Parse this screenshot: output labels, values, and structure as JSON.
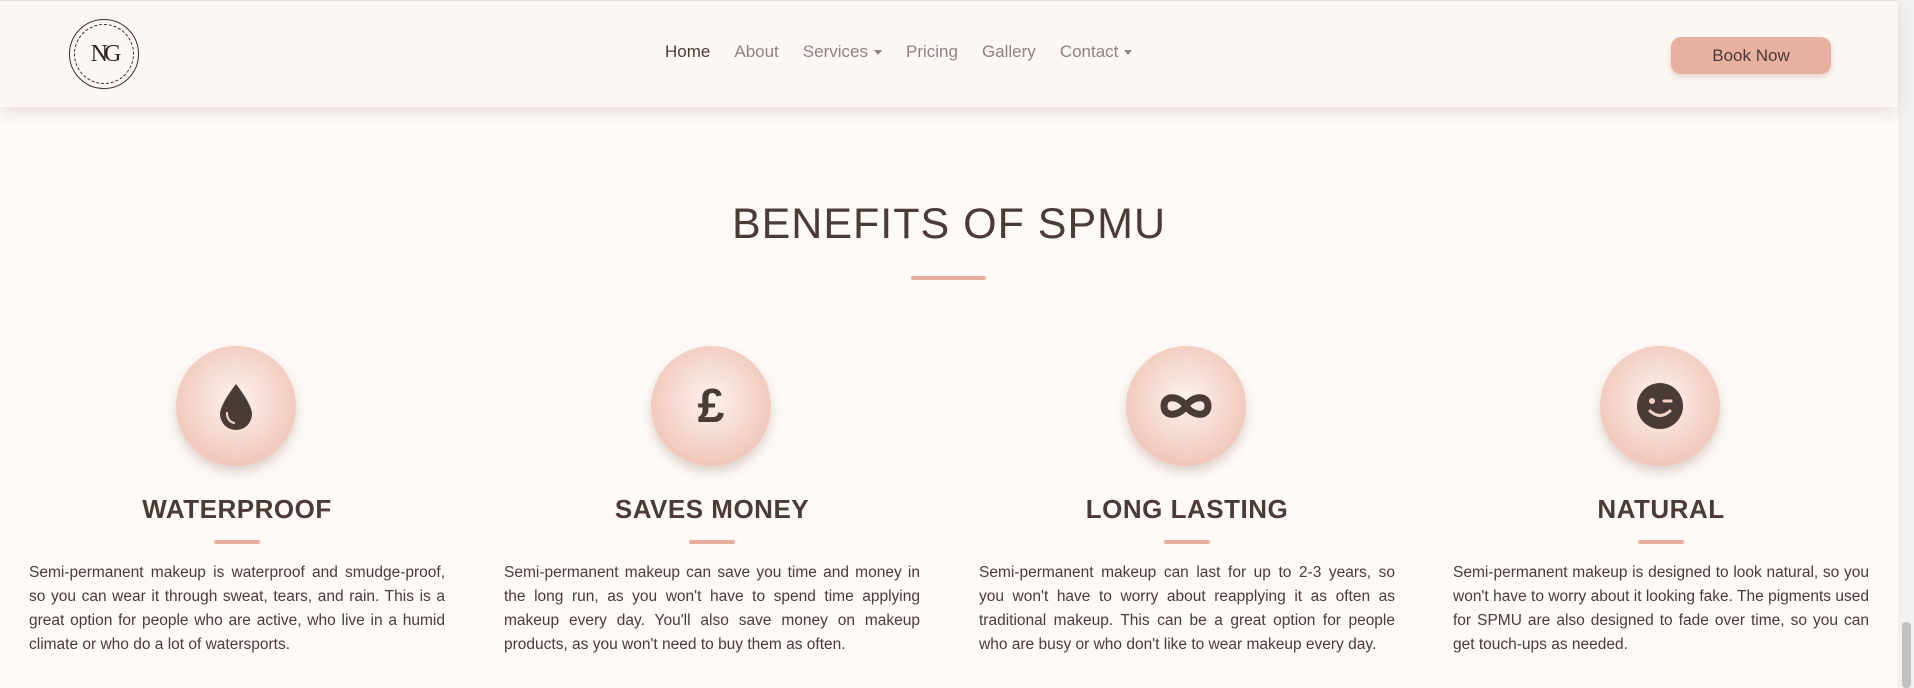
{
  "header": {
    "logo_text": "NG",
    "nav": [
      {
        "label": "Home",
        "dropdown": false,
        "active": true
      },
      {
        "label": "About",
        "dropdown": false,
        "active": false
      },
      {
        "label": "Services",
        "dropdown": true,
        "active": false
      },
      {
        "label": "Pricing",
        "dropdown": false,
        "active": false
      },
      {
        "label": "Gallery",
        "dropdown": false,
        "active": false
      },
      {
        "label": "Contact",
        "dropdown": true,
        "active": false
      }
    ],
    "book_button": "Book Now"
  },
  "section": {
    "title": "BENEFITS OF SPMU"
  },
  "benefits": [
    {
      "icon": "water-drop-icon",
      "title": "WATERPROOF",
      "text": "Semi-permanent makeup is waterproof and smudge-proof, so you can wear it through sweat, tears, and rain. This is a great option for people who are active, who live in a humid climate or who do a lot of watersports."
    },
    {
      "icon": "pound-sign-icon",
      "title": "SAVES MONEY",
      "text": "Semi-permanent makeup can save you time and money in the long run, as you won't have to spend time applying makeup every day. You'll also save money on makeup products, as you won't need to buy them as often."
    },
    {
      "icon": "infinity-icon",
      "title": "LONG LASTING",
      "text": "Semi-permanent makeup can last for up to 2-3 years, so you won't have to worry about reapplying it as often as traditional makeup. This can be a great option for people who are busy or who don't like to wear makeup every day."
    },
    {
      "icon": "wink-face-icon",
      "title": "NATURAL",
      "text": "Semi-permanent makeup is designed to look natural, so you won't have to worry about it looking fake. The pigments used for SPMU are also designed to fade over time, so you can get touch-ups as needed."
    }
  ],
  "colors": {
    "accent": "#e8ad9c",
    "text": "#4a3b37",
    "background": "#fdf9f7"
  }
}
